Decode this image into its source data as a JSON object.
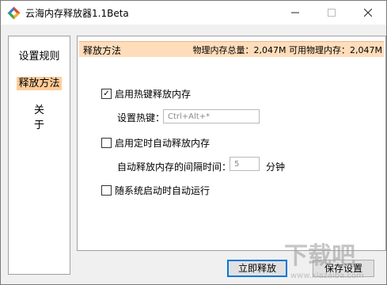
{
  "window": {
    "title": "云海内存释放器1.1Beta"
  },
  "sidebar": {
    "items": [
      {
        "label": "设置规则"
      },
      {
        "label": "释放方法"
      },
      {
        "label": "关 于"
      }
    ]
  },
  "header": {
    "title": "释放方法",
    "info": "物理内存总量：2,047M 可用物理内存：2,047M"
  },
  "options": {
    "hotkey_enable": {
      "label": "启用热键释放内存",
      "checked": "✓"
    },
    "hotkey_label": "设置热键：",
    "hotkey_value": "Ctrl+Alt+*",
    "timer_enable": {
      "label": "启用定时自动释放内存",
      "checked": ""
    },
    "interval_label": "自动释放内存的间隔时间：",
    "interval_value": "5",
    "interval_unit": "分钟",
    "startup_enable": {
      "label": "随系统启动时自动运行",
      "checked": ""
    }
  },
  "buttons": {
    "release_now": "立即释放",
    "save_settings": "保存设置"
  },
  "watermark": {
    "text": "下载吧",
    "url_text": "www.xiazaiba.com"
  }
}
